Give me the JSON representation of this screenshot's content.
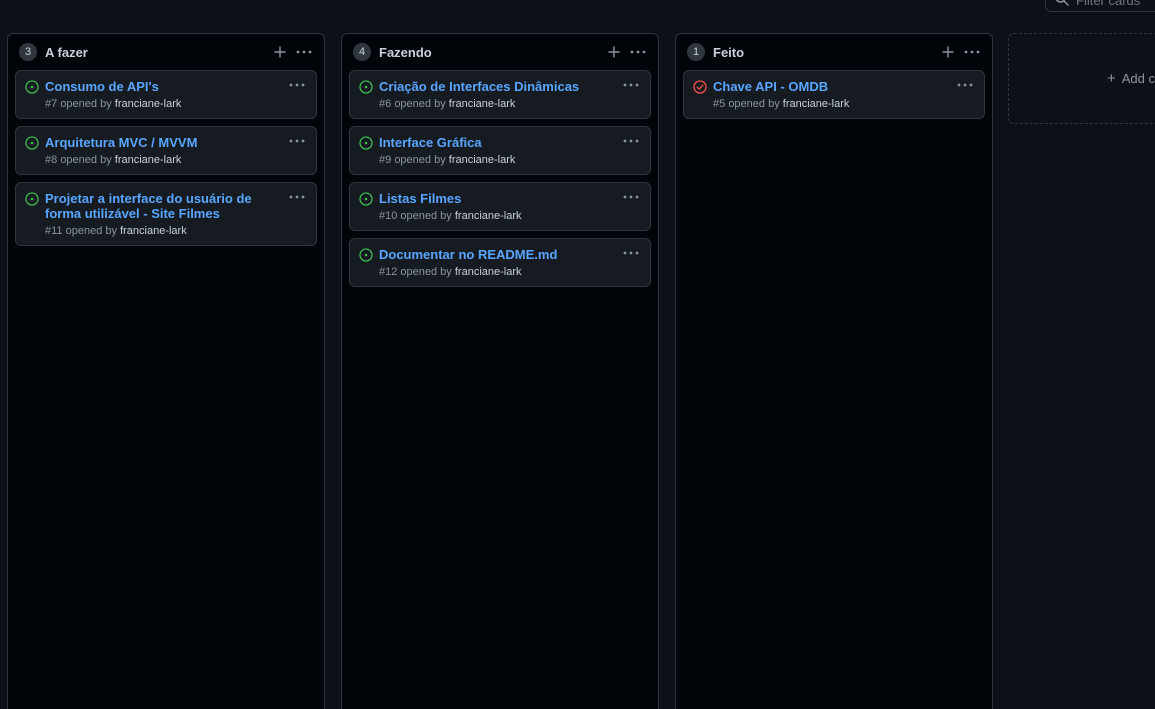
{
  "filter": {
    "placeholder": "Filter cards"
  },
  "columns": [
    {
      "count": "3",
      "title": "A fazer",
      "cards": [
        {
          "title": "Consumo de API's",
          "number": "#7",
          "opened_by": "opened by",
          "author": "franciane-lark",
          "state": "open"
        },
        {
          "title": "Arquitetura MVC / MVVM",
          "number": "#8",
          "opened_by": "opened by",
          "author": "franciane-lark",
          "state": "open"
        },
        {
          "title": "Projetar a interface do usuário de forma utilizável - Site Filmes",
          "number": "#11",
          "opened_by": "opened by",
          "author": "franciane-lark",
          "state": "open"
        }
      ]
    },
    {
      "count": "4",
      "title": "Fazendo",
      "cards": [
        {
          "title": "Criação de Interfaces Dinâmicas",
          "number": "#6",
          "opened_by": "opened by",
          "author": "franciane-lark",
          "state": "open"
        },
        {
          "title": "Interface Gráfica",
          "number": "#9",
          "opened_by": "opened by",
          "author": "franciane-lark",
          "state": "open"
        },
        {
          "title": "Listas Filmes",
          "number": "#10",
          "opened_by": "opened by",
          "author": "franciane-lark",
          "state": "open"
        },
        {
          "title": "Documentar no README.md",
          "number": "#12",
          "opened_by": "opened by",
          "author": "franciane-lark",
          "state": "open"
        }
      ]
    },
    {
      "count": "1",
      "title": "Feito",
      "cards": [
        {
          "title": "Chave API - OMDB",
          "number": "#5",
          "opened_by": "opened by",
          "author": "franciane-lark",
          "state": "closed"
        }
      ]
    }
  ],
  "add_column": {
    "label": "Add c"
  },
  "icons": {
    "open_issue": "issue-opened-icon",
    "closed_issue": "issue-closed-icon",
    "plus": "plus-icon",
    "kebab": "kebab-horizontal-icon",
    "search": "search-icon"
  },
  "colors": {
    "background": "#0d1117",
    "column_bg": "#010409",
    "card_bg": "#161b22",
    "border": "#30363d",
    "link": "#58a6ff",
    "open": "#3fb950",
    "closed": "#f85149",
    "muted": "#8b949e"
  }
}
